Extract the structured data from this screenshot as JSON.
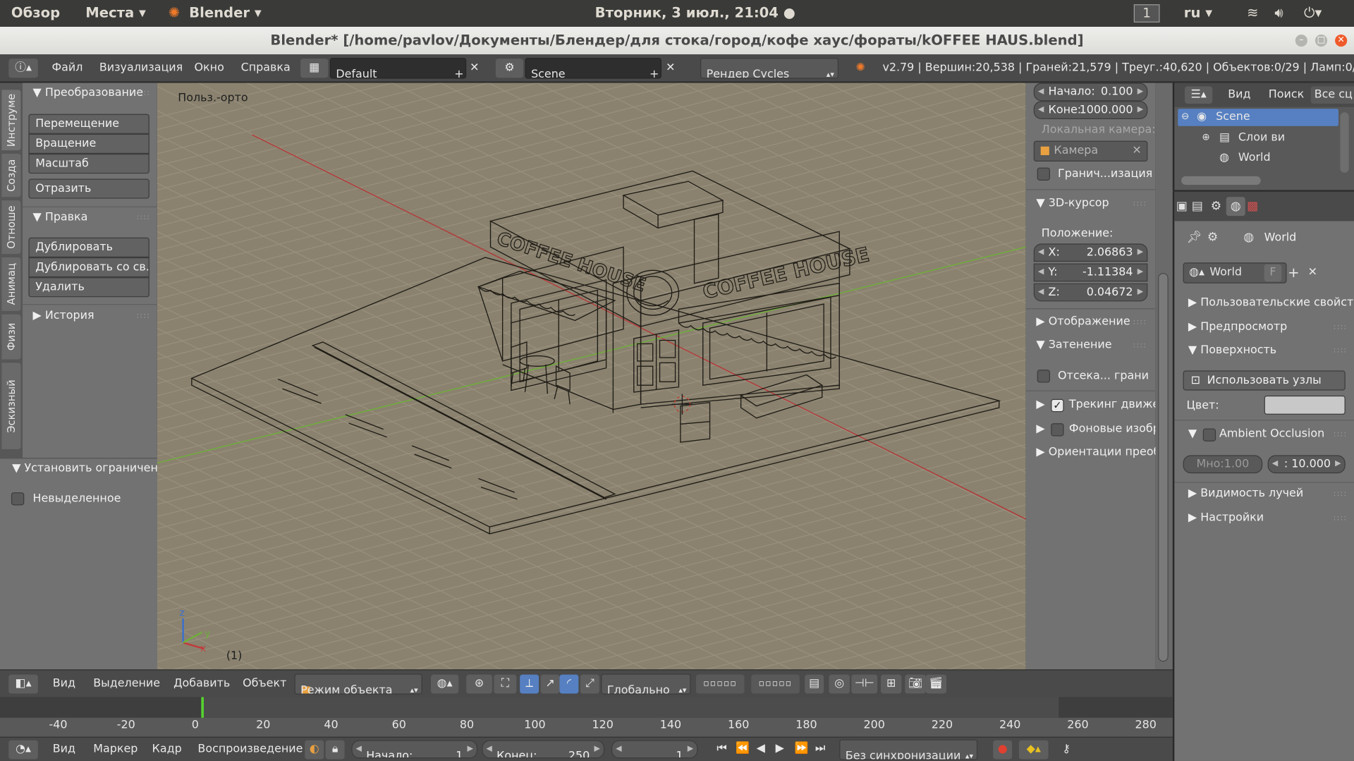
{
  "system_bar": {
    "overview": "Обзор",
    "places": "Места ▾",
    "app": "Blender ▾",
    "clock": "Вторник,  3 июл., 21:04 ●",
    "workspace": "1",
    "lang": "ru ▾"
  },
  "window": {
    "title": "Blender* [/home/pavlov/Документы/Блендер/для стока/город/кофе хаус/фораты/kOFFEE HAUS.blend]"
  },
  "info_header": {
    "menu": [
      "Файл",
      "Визуализация",
      "Окно",
      "Справка"
    ],
    "screen_layout": "Default",
    "scene": "Scene",
    "engine": "Рендер Cycles",
    "stats": "v2.79 | Вершин:20,538 | Граней:21,579 | Треуг.:40,620 | Объектов:0/29 | Ламп:0/1 | Пам.:"
  },
  "left_tabs": [
    "Инструме",
    "Созда",
    "Отноше",
    "Анимац",
    "Физи",
    "Эскизный каран"
  ],
  "tool_shelf": {
    "transform": {
      "title": "Преобразование",
      "buttons": [
        "Перемещение",
        "Вращение",
        "Масштаб"
      ],
      "mirror": "Отразить"
    },
    "edit": {
      "title": "Правка",
      "buttons": [
        "Дублировать",
        "Дублировать со св...",
        "Удалить"
      ]
    },
    "history": {
      "title": "История"
    },
    "constraint": {
      "title": "Установить ограничение",
      "unselected": "Невыделенное"
    }
  },
  "viewport": {
    "view_label": "Польз.-орто",
    "frame": "(1)",
    "sign_left": "COFFEE HOUSE",
    "sign_right": "COFFEE HOUSE",
    "axes": {
      "x": "x",
      "y": "y",
      "z": "z"
    }
  },
  "properties_n": {
    "clip_start": {
      "label": "Начало:",
      "value": "0.100"
    },
    "clip_end": {
      "label": "Коне:",
      "value": "1000.000"
    },
    "local_camera_label": "Локальная камера:",
    "camera_field": "Камера",
    "border_render": "Гранич...изация",
    "cursor_title": "3D-курсор",
    "position_label": "Положение:",
    "cursor": [
      {
        "label": "X:",
        "value": "2.06863"
      },
      {
        "label": "Y:",
        "value": "-1.11384"
      },
      {
        "label": "Z:",
        "value": "0.04672"
      }
    ],
    "display": "Отображение",
    "shading": "Затенение",
    "backface": "Отсека... грани",
    "motion_tracking": "Трекинг движен",
    "motion_tracking_checked": true,
    "background_images": "Фоновые изобра",
    "transform_orientations": "Ориентации преобр"
  },
  "outliner": {
    "view": "Вид",
    "search": "Поиск",
    "filter": "Все сц",
    "items": [
      "Scene",
      "Слои ви",
      "World"
    ]
  },
  "world_props": {
    "breadcrumb": "World",
    "datablock": "World",
    "fake_user": "F",
    "sections": {
      "custom_props": "Пользовательские свойства",
      "preview": "Предпросмотр",
      "surface": "Поверхность"
    },
    "use_nodes": "Использовать узлы",
    "color_label": "Цвет:",
    "color_value": "#c8c8c8",
    "ao": "Ambient Occlusion",
    "ao_factor": "Мно:1.00",
    "ao_distance": ": 10.000",
    "ray_visibility": "Видимость лучей",
    "settings": "Настройки"
  },
  "view3d_header": {
    "menu": [
      "Вид",
      "Выделение",
      "Добавить",
      "Объект"
    ],
    "mode": "Режим объекта",
    "orientation": "Глобально"
  },
  "timeline": {
    "ticks": [
      "-40",
      "-20",
      "0",
      "20",
      "40",
      "60",
      "80",
      "100",
      "120",
      "140",
      "160",
      "180",
      "200",
      "220",
      "240",
      "260",
      "280"
    ],
    "current_frame": 1
  },
  "timeline_header": {
    "menu": [
      "Вид",
      "Маркер",
      "Кадр",
      "Воспроизведение"
    ],
    "start": {
      "label": "Начало:",
      "value": "1"
    },
    "end": {
      "label": "Конец:",
      "value": "250"
    },
    "current": "1",
    "sync": "Без синхронизации"
  },
  "colors": {
    "viewport_bg": "#8a826f",
    "x_axis": "#b23a3a",
    "y_axis": "#6fae3a",
    "panel": "#727272",
    "header": "#4a4a4a",
    "accent_blue": "#5680c2"
  }
}
